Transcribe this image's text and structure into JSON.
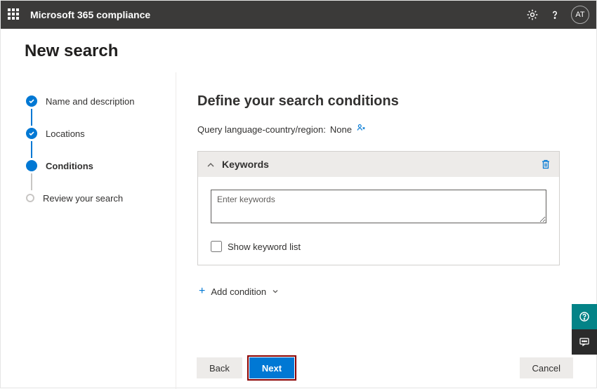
{
  "header": {
    "brand": "Microsoft 365 compliance",
    "avatar_initials": "AT"
  },
  "page": {
    "title": "New search"
  },
  "steps": [
    {
      "label": "Name and description",
      "state": "done"
    },
    {
      "label": "Locations",
      "state": "done"
    },
    {
      "label": "Conditions",
      "state": "current"
    },
    {
      "label": "Review your search",
      "state": "future"
    }
  ],
  "content": {
    "heading": "Define your search conditions",
    "query_label_prefix": "Query language-country/region:",
    "query_value": "None",
    "panel": {
      "title": "Keywords",
      "placeholder": "Enter keywords",
      "value": "",
      "show_list_label": "Show keyword list"
    },
    "add_condition_label": "Add condition"
  },
  "buttons": {
    "back": "Back",
    "next": "Next",
    "cancel": "Cancel"
  }
}
